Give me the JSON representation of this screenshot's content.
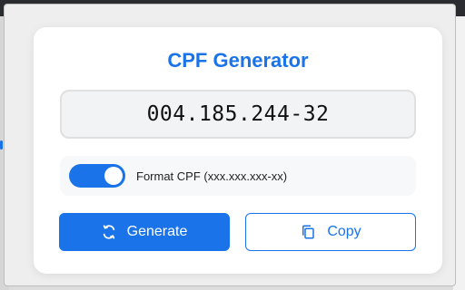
{
  "app": {
    "title": "CPF Generator"
  },
  "cpf": {
    "value": "004.185.244-32"
  },
  "format_toggle": {
    "label": "Format CPF (xxx.xxx.xxx-xx)",
    "checked": true
  },
  "buttons": {
    "generate_label": "Generate",
    "copy_label": "Copy"
  },
  "icons": {
    "generate": "refresh-icon",
    "copy": "copy-icon"
  },
  "colors": {
    "accent": "#1a73e8",
    "display_bg": "#f1f3f4",
    "card_bg": "#ffffff"
  }
}
